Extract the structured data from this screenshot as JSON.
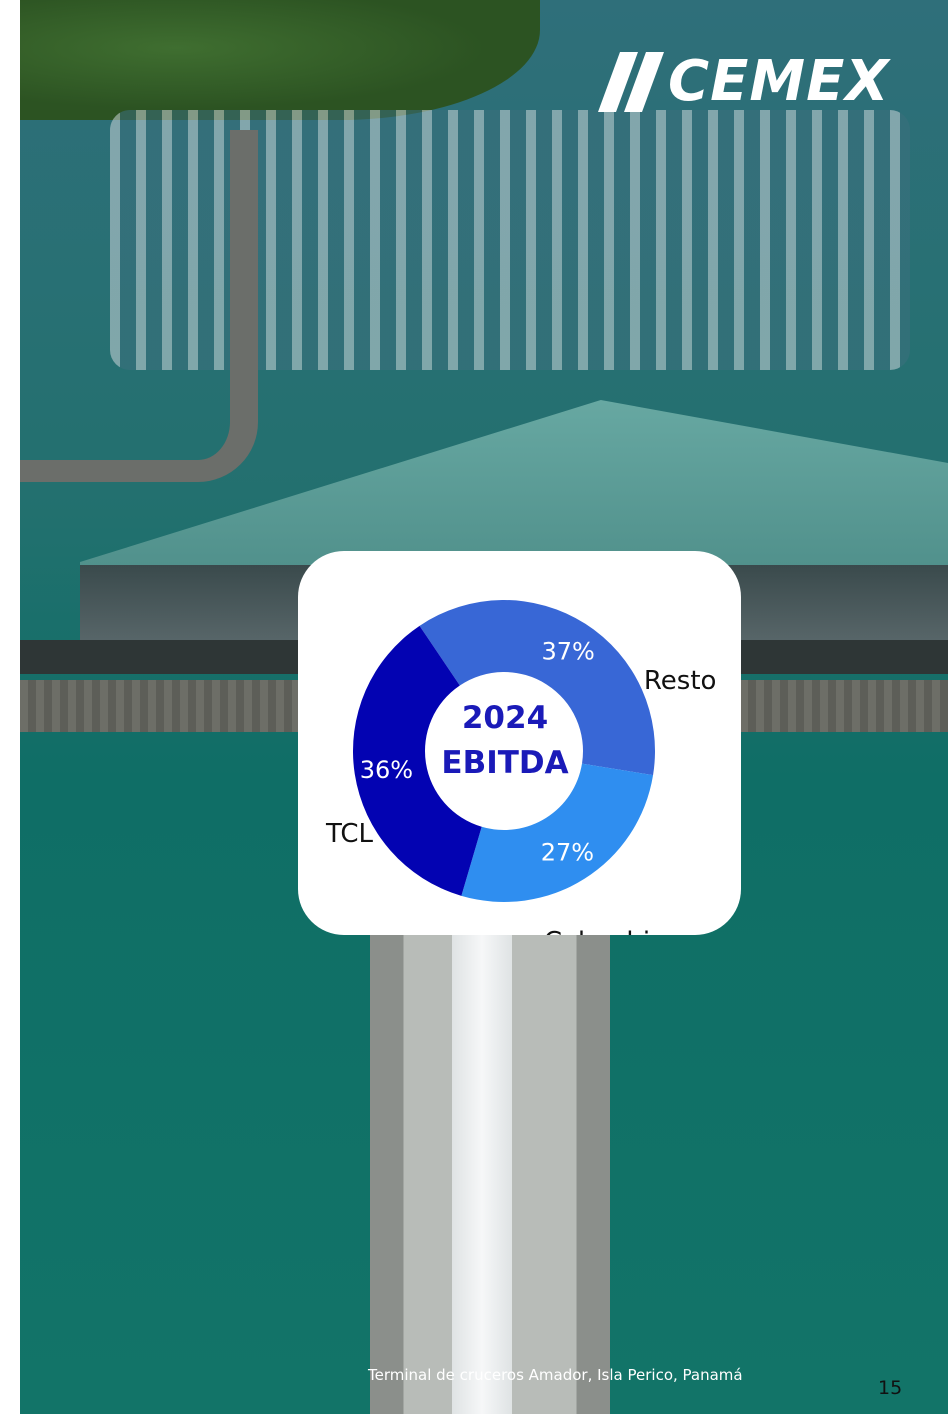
{
  "logo": {
    "text": "CEMEX"
  },
  "caption": "Terminal de cruceros Amador, Isla Perico, Panamá",
  "page_number": "15",
  "colors": {
    "resto": "#3867d6",
    "colombia": "#2f8ef0",
    "tcl": "#0303b2",
    "center_text": "#1a1ab8"
  },
  "chart_data": {
    "type": "pie",
    "donut": true,
    "center_label": [
      "2024",
      "EBITDA"
    ],
    "slices": [
      {
        "label": "Resto",
        "value": 37,
        "value_label": "37%",
        "color": "#3867d6"
      },
      {
        "label": "Colombia",
        "value": 27,
        "value_label": "27%",
        "color": "#2f8ef0"
      },
      {
        "label": "TCL",
        "value": 36,
        "value_label": "36%",
        "color": "#0303b2"
      }
    ]
  }
}
